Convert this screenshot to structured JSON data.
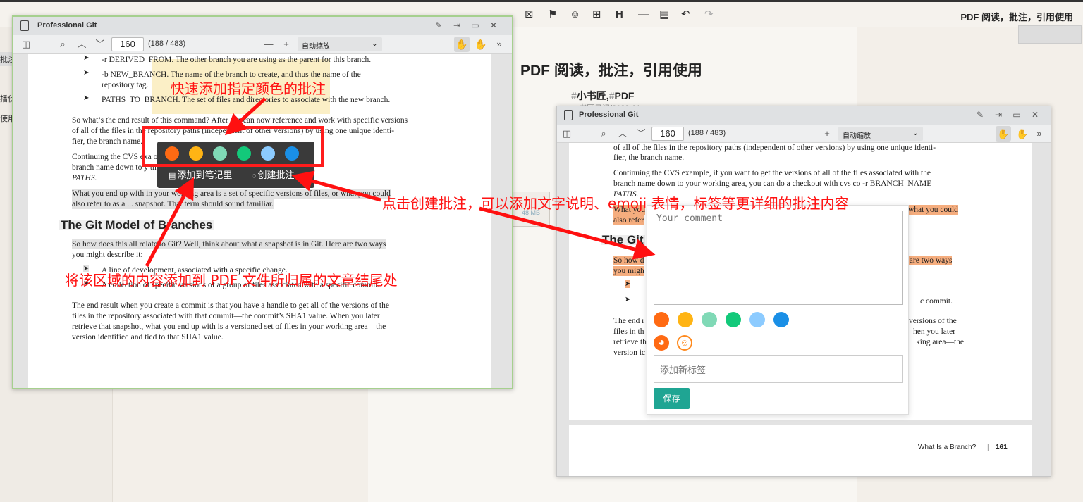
{
  "background": {
    "toolbar_icons": [
      "⊠",
      "⚑",
      "☺",
      "⊞",
      "H",
      "—",
      "▤",
      "↶",
      "↷"
    ],
    "doc_title": "PDF 阅读，批注，引用使用",
    "left_labels": [
      "批注",
      "播使",
      "使用"
    ],
    "heading": "PDF 阅读，批注，引用使用",
    "tags": [
      "小书匠",
      "PDF"
    ],
    "subline": "小书匠日记/2022-01",
    "size_label": "48 MB"
  },
  "viewer1": {
    "title": "Professional Git",
    "page_number": "160",
    "page_count": "(188 / 483)",
    "zoom": "自动缩放",
    "lines": [
      {
        "t": "-r DERIVED_FROM. The other branch you are using as the parent for this branch."
      },
      {
        "t": "-b NEW_BRANCH. The name of the branch to create, and thus the name of the"
      },
      {
        "t": "repository tag."
      },
      {
        "t": "PATHS_TO_BRANCH. The set of files and directories to associate with the new branch."
      },
      {
        "t": "So what’s the end result of this command? After our can now reference and work with specific versions"
      },
      {
        "t": "of all of the files in the repository paths (independent of other versions) by using one unique identi-"
      },
      {
        "t": "fier, the branch name."
      },
      {
        "t": "Continuing the CVS exa                                   of the files associated with the"
      },
      {
        "t": "branch name down to y                                    th cvs co -r BRANCH_NAME"
      },
      {
        "t": "PATHS."
      },
      {
        "t": "What you end up with in your working area is a set of specific versions of files, or what you could"
      },
      {
        "t": "also refer to as a ... snapshot. That term should sound familiar."
      },
      {
        "t": "The Git Model of Branches"
      },
      {
        "t": "So how does this all relate to Git? Well, think about what a snapshot is in Git. Here are two ways"
      },
      {
        "t": "you might describe it:"
      },
      {
        "t": "A line of development, associated with a specific change."
      },
      {
        "t": "A collection of specific versions of a group of files associated with a specific commit."
      },
      {
        "t": "The end result when you create a commit is that you have a handle to get all of the versions of the"
      },
      {
        "t": "files in the repository associated with that commit—the commit’s SHA1 value. When you later"
      },
      {
        "t": "retrieve that snapshot, what you end up with is a versioned set of files in your working area—the"
      },
      {
        "t": "version identified and tied to that SHA1 value."
      }
    ],
    "popup": {
      "add_note_label": "添加到笔记里",
      "create_annotation_label": "创建批注"
    }
  },
  "colors": [
    "#ff6a13",
    "#ffb414",
    "#80d9b6",
    "#13c97a",
    "#8ccbff",
    "#1a8fe6"
  ],
  "viewer2": {
    "title": "Professional Git",
    "page_number": "160",
    "page_count": "(188 / 483)",
    "zoom": "自动缩放",
    "lines": [
      {
        "t": "of all of the files in the repository paths (independent of other versions) by using one unique identi-"
      },
      {
        "t": "fier, the branch name."
      },
      {
        "t": "Continuing the CVS example, if you want to get the versions of all of the files associated with the"
      },
      {
        "t": "branch name down to your working area, you can do a checkout with cvs co -r BRANCH_NAME"
      },
      {
        "t": "PATHS."
      },
      {
        "t": "What you"
      },
      {
        "t": "what you could"
      },
      {
        "t": "also refer"
      },
      {
        "t": "The Git"
      },
      {
        "t": "So how d"
      },
      {
        "t": "re are two ways"
      },
      {
        "t": "you migh"
      },
      {
        "t": "c commit."
      },
      {
        "t": "The end r"
      },
      {
        "t": "e versions of the"
      },
      {
        "t": "files in th"
      },
      {
        "t": "hen you later"
      },
      {
        "t": "retrieve th"
      },
      {
        "t": "king area—the"
      },
      {
        "t": "version ic"
      }
    ],
    "footer_title": "What Is a Branch?",
    "footer_page": "161",
    "comment": {
      "placeholder": "Your comment",
      "tag_placeholder": "添加新标签",
      "save_label": "保存"
    }
  },
  "annotations": {
    "color_label": "快速添加指定颜色的批注",
    "create_label": "点击创建批注，可以添加文字说明、emoji 表情，标签等更详细的批注内容",
    "note_label": "将该区域的内容添加到 PDF 文件所归属的文章结尾处"
  }
}
